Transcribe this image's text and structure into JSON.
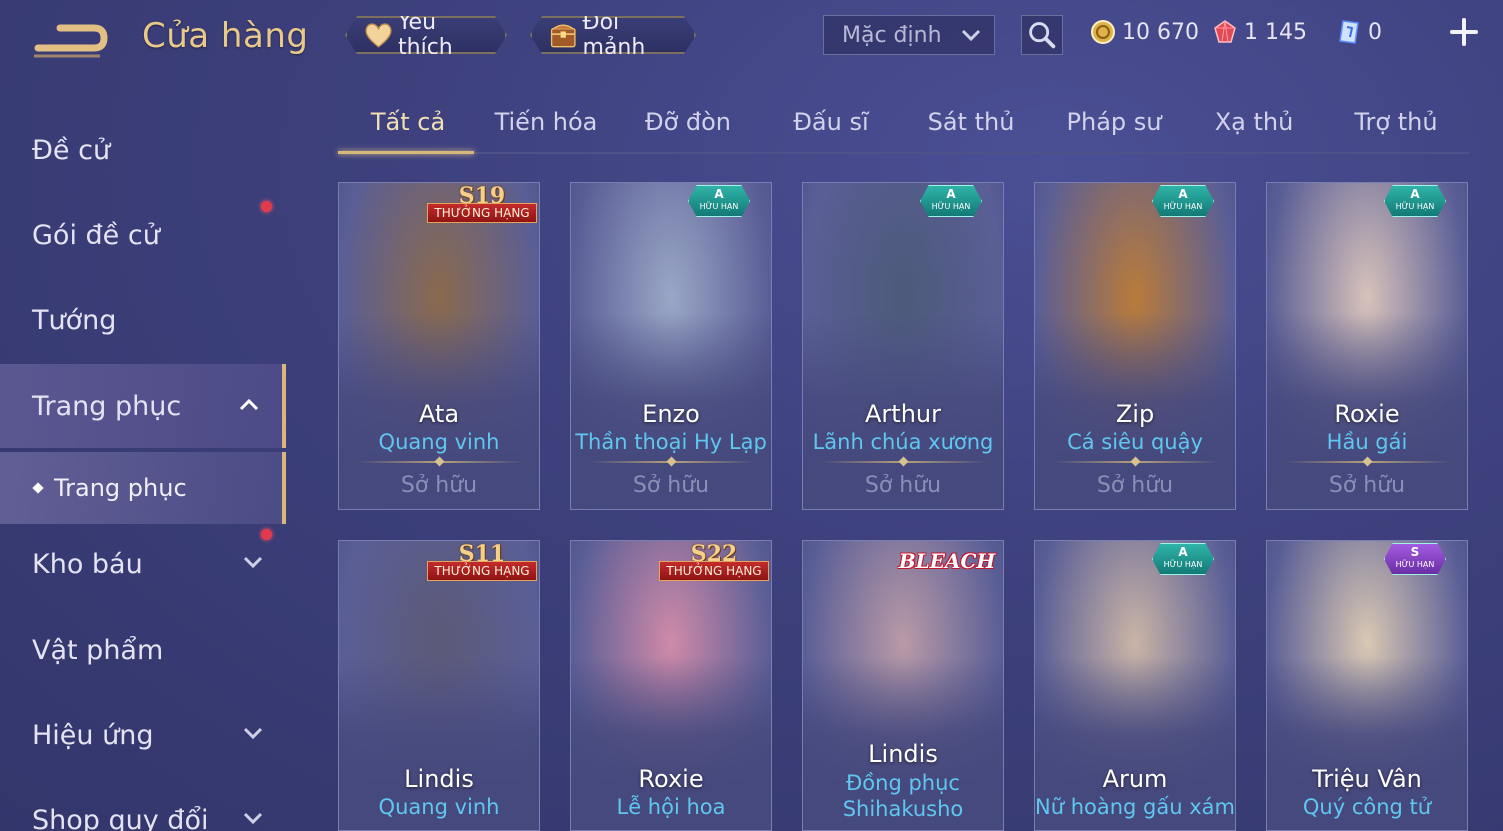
{
  "header": {
    "title": "Cửa hàng",
    "favorites_label": "Yêu thích",
    "fragments_label": "Đổi mảnh",
    "sort_value": "Mặc định",
    "currencies": [
      {
        "name": "gold-coin",
        "value": "10 670",
        "color": "#e0b24a"
      },
      {
        "name": "ruby",
        "value": "1 145",
        "color": "#e04a55"
      },
      {
        "name": "voucher",
        "value": "0",
        "color": "#6ea6ff"
      }
    ]
  },
  "sidebar": {
    "items": [
      {
        "label": "Đề cử"
      },
      {
        "label": "Gói đề cử"
      },
      {
        "label": "Tướng"
      },
      {
        "label": "Trang phục"
      },
      {
        "label": "Trang phục"
      },
      {
        "label": "Kho báu"
      },
      {
        "label": "Vật phẩm"
      },
      {
        "label": "Hiệu ứng"
      },
      {
        "label": "Shop quy đổi"
      }
    ]
  },
  "tabs": [
    "Tất cả",
    "Tiến hóa",
    "Đỡ đòn",
    "Đấu sĩ",
    "Sát thủ",
    "Pháp sư",
    "Xạ thủ",
    "Trợ thủ"
  ],
  "badges": {
    "ranked_ribbon": "THƯỞNG HẠNG",
    "limited_text": "HỮU HẠN",
    "bleach": "BLEACH"
  },
  "cards": [
    {
      "hero": "Ata",
      "skin": "Quang vinh",
      "status": "Sở hữu",
      "badge_type": "ranked",
      "badge_text": "S19",
      "art_color": "#8a6a4e"
    },
    {
      "hero": "Enzo",
      "skin": "Thần thoại Hy Lạp",
      "status": "Sở hữu",
      "badge_type": "limited",
      "badge_text": "A",
      "art_color": "#9aa7c6"
    },
    {
      "hero": "Arthur",
      "skin": "Lãnh chúa xương",
      "status": "Sở hữu",
      "badge_type": "limited",
      "badge_text": "A",
      "art_color": "#4c5a7a"
    },
    {
      "hero": "Zip",
      "skin": "Cá siêu quậy",
      "status": "Sở hữu",
      "badge_type": "limited",
      "badge_text": "A",
      "art_color": "#b97b3a"
    },
    {
      "hero": "Roxie",
      "skin": "Hầu gái",
      "status": "Sở hữu",
      "badge_type": "limited",
      "badge_text": "A",
      "art_color": "#d7c2ba"
    },
    {
      "hero": "Lindis",
      "skin": "Quang vinh",
      "badge_type": "ranked",
      "badge_text": "S11",
      "art_color": "#5c5a78"
    },
    {
      "hero": "Roxie",
      "skin": "Lễ hội hoa",
      "badge_type": "ranked",
      "badge_text": "S22",
      "art_color": "#cf8aa8"
    },
    {
      "hero": "Lindis",
      "skin": "Đồng phục\nShihakusho",
      "badge_type": "bleach",
      "badge_text": "BLEACH",
      "art_color": "#b99aa7"
    },
    {
      "hero": "Arum",
      "skin": "Nữ hoàng gấu xám",
      "badge_type": "limited",
      "badge_text": "A",
      "art_color": "#c9b4a6"
    },
    {
      "hero": "Triệu Vân",
      "skin": "Quý công tử",
      "badge_type": "limited",
      "badge_text": "S",
      "art_color": "#d9c8b3"
    }
  ]
}
